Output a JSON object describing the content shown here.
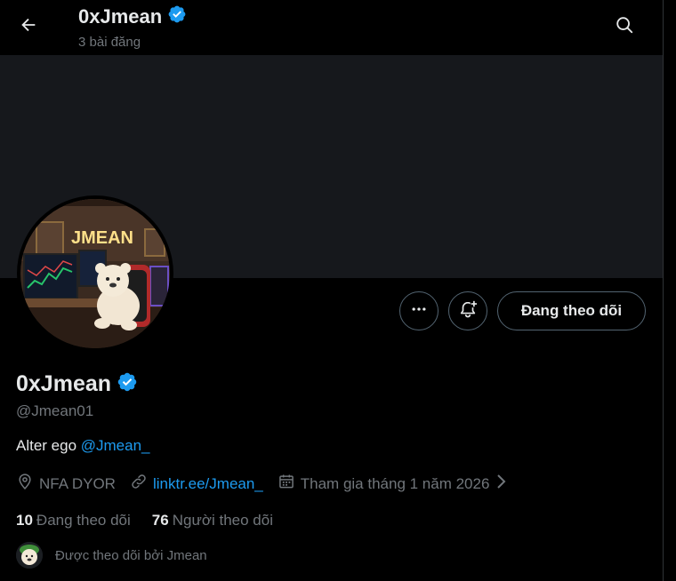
{
  "header": {
    "title": "0xJmean",
    "post_count": "3 bài đăng"
  },
  "profile": {
    "display_name": "0xJmean",
    "handle": "@Jmean01",
    "bio_prefix": "Alter ego ",
    "bio_mention": "@Jmean_",
    "location": "NFA DYOR",
    "link": "linktr.ee/Jmean_",
    "joined": "Tham gia tháng 1 năm 2026",
    "following_count": "10",
    "following_label": "Đang theo dõi",
    "followers_count": "76",
    "followers_label": "Người theo dõi",
    "followed_by": "Được theo dõi bởi Jmean",
    "avatar_sign_text": "JMEAN"
  },
  "actions": {
    "follow_label": "Đang theo dõi"
  },
  "colors": {
    "accent": "#1d9bf0",
    "muted": "#71767b",
    "banner": "#16181c",
    "verified": "#1d9bf0"
  },
  "icons": {
    "back": "arrow-left-icon",
    "search": "search-icon",
    "more": "more-icon",
    "notify": "bell-plus-icon",
    "verified": "verified-badge-icon",
    "location": "location-icon",
    "link": "link-icon",
    "calendar": "calendar-icon",
    "chevron": "chevron-right-icon"
  }
}
